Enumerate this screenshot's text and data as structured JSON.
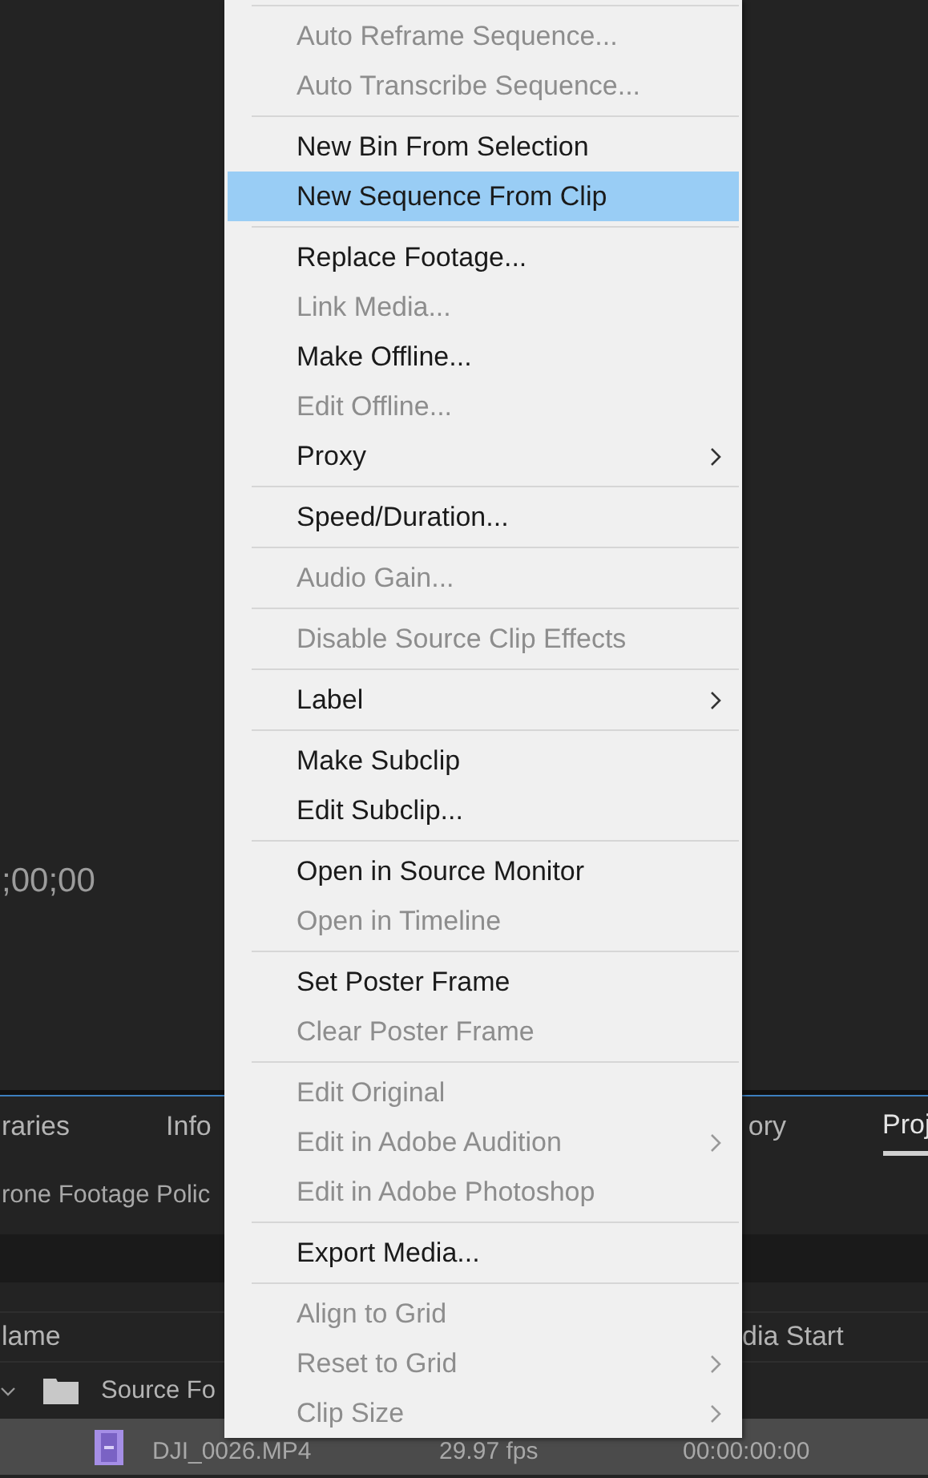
{
  "monitor": {
    "timecode": ";00;00"
  },
  "panel_tabs": [
    {
      "label": "raries",
      "selected": false
    },
    {
      "label": "Info",
      "selected": false
    },
    {
      "label": "ory",
      "selected": false
    },
    {
      "label": "Proj",
      "selected": true
    }
  ],
  "bin_path": "rone Footage Polic",
  "columns": [
    "lame",
    "dia Start"
  ],
  "rows": [
    {
      "kind": "bin",
      "name": "Source Fo",
      "expanded": true,
      "selected": false
    },
    {
      "kind": "clip",
      "name": "DJI_0026.MP4",
      "frame_rate": "29.97 fps",
      "media_start": "00:00:00:00",
      "selected": true
    }
  ],
  "context_menu": {
    "groups": [
      [
        {
          "label": "Auto Reframe Sequence...",
          "disabled": true,
          "submenu": false,
          "selected": false
        },
        {
          "label": "Auto Transcribe Sequence...",
          "disabled": true,
          "submenu": false,
          "selected": false
        }
      ],
      [
        {
          "label": "New Bin From Selection",
          "disabled": false,
          "submenu": false,
          "selected": false
        },
        {
          "label": "New Sequence From Clip",
          "disabled": false,
          "submenu": false,
          "selected": true
        }
      ],
      [
        {
          "label": "Replace Footage...",
          "disabled": false,
          "submenu": false,
          "selected": false
        },
        {
          "label": "Link Media...",
          "disabled": true,
          "submenu": false,
          "selected": false
        },
        {
          "label": "Make Offline...",
          "disabled": false,
          "submenu": false,
          "selected": false
        },
        {
          "label": "Edit Offline...",
          "disabled": true,
          "submenu": false,
          "selected": false
        },
        {
          "label": "Proxy",
          "disabled": false,
          "submenu": true,
          "selected": false
        }
      ],
      [
        {
          "label": "Speed/Duration...",
          "disabled": false,
          "submenu": false,
          "selected": false
        }
      ],
      [
        {
          "label": "Audio Gain...",
          "disabled": true,
          "submenu": false,
          "selected": false
        }
      ],
      [
        {
          "label": "Disable Source Clip Effects",
          "disabled": true,
          "submenu": false,
          "selected": false
        }
      ],
      [
        {
          "label": "Label",
          "disabled": false,
          "submenu": true,
          "selected": false
        }
      ],
      [
        {
          "label": "Make Subclip",
          "disabled": false,
          "submenu": false,
          "selected": false
        },
        {
          "label": "Edit Subclip...",
          "disabled": false,
          "submenu": false,
          "selected": false
        }
      ],
      [
        {
          "label": "Open in Source Monitor",
          "disabled": false,
          "submenu": false,
          "selected": false
        },
        {
          "label": "Open in Timeline",
          "disabled": true,
          "submenu": false,
          "selected": false
        }
      ],
      [
        {
          "label": "Set Poster Frame",
          "disabled": false,
          "submenu": false,
          "selected": false
        },
        {
          "label": "Clear Poster Frame",
          "disabled": true,
          "submenu": false,
          "selected": false
        }
      ],
      [
        {
          "label": "Edit Original",
          "disabled": true,
          "submenu": false,
          "selected": false
        },
        {
          "label": "Edit in Adobe Audition",
          "disabled": true,
          "submenu": true,
          "selected": false
        },
        {
          "label": "Edit in Adobe Photoshop",
          "disabled": true,
          "submenu": false,
          "selected": false
        }
      ],
      [
        {
          "label": "Export Media...",
          "disabled": false,
          "submenu": false,
          "selected": false
        }
      ],
      [
        {
          "label": "Align to Grid",
          "disabled": true,
          "submenu": false,
          "selected": false
        },
        {
          "label": "Reset to Grid",
          "disabled": true,
          "submenu": true,
          "selected": false
        },
        {
          "label": "Clip Size",
          "disabled": true,
          "submenu": true,
          "selected": false
        }
      ]
    ]
  }
}
